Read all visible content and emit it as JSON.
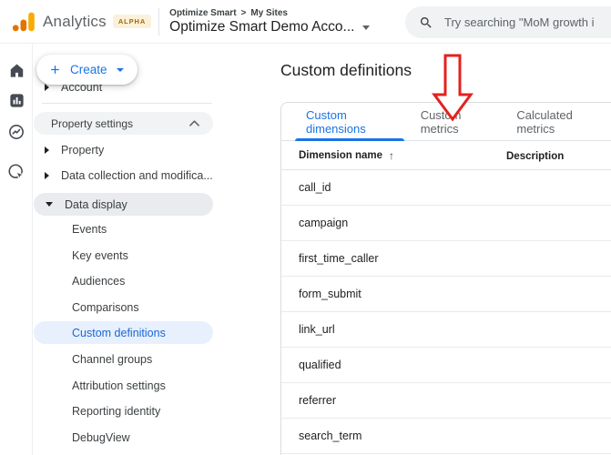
{
  "header": {
    "product_name": "Analytics",
    "badge": "ALPHA",
    "breadcrumb": {
      "account": "Optimize Smart",
      "separator": ">",
      "section": "My Sites"
    },
    "property_selector": "Optimize Smart Demo Acco...",
    "search": {
      "placeholder": "Try searching \"MoM growth i"
    }
  },
  "icon_rail": {
    "items": [
      {
        "icon": "home-icon"
      },
      {
        "icon": "reports-icon"
      },
      {
        "icon": "explore-icon"
      },
      {
        "icon": "advertising-icon"
      }
    ]
  },
  "sidebar": {
    "create_label": "Create",
    "account_label": "Account",
    "section_header": "Property settings",
    "parents": [
      {
        "label": "Property",
        "state": "collapsed"
      },
      {
        "label": "Data collection and modifica...",
        "state": "collapsed"
      },
      {
        "label": "Data display",
        "state": "expanded"
      }
    ],
    "children": [
      "Events",
      "Key events",
      "Audiences",
      "Comparisons",
      "Custom definitions",
      "Channel groups",
      "Attribution settings",
      "Reporting identity",
      "DebugView"
    ],
    "active_item": "Custom definitions"
  },
  "main": {
    "title": "Custom definitions",
    "tabs": [
      {
        "label": "Custom dimensions",
        "active": true
      },
      {
        "label": "Custom metrics",
        "active": false
      },
      {
        "label": "Calculated metrics",
        "active": false
      }
    ],
    "table": {
      "columns": {
        "name": "Dimension name",
        "description": "Description"
      },
      "sort_icon": "↑",
      "rows": [
        {
          "name": "call_id",
          "description": ""
        },
        {
          "name": "campaign",
          "description": ""
        },
        {
          "name": "first_time_caller",
          "description": ""
        },
        {
          "name": "form_submit",
          "description": ""
        },
        {
          "name": "link_url",
          "description": ""
        },
        {
          "name": "qualified",
          "description": ""
        },
        {
          "name": "referrer",
          "description": ""
        },
        {
          "name": "search_term",
          "description": ""
        }
      ]
    },
    "annotation": {
      "shape": "down-arrow",
      "color": "#e4211c",
      "target_tab": "Custom metrics"
    }
  },
  "colors": {
    "accent_blue": "#1a73e8",
    "selected_item_bg": "#e8f0fe",
    "logo_orange": "#f9ab00",
    "logo_orange_dark": "#e37400",
    "annotation_red": "#e4211c"
  }
}
